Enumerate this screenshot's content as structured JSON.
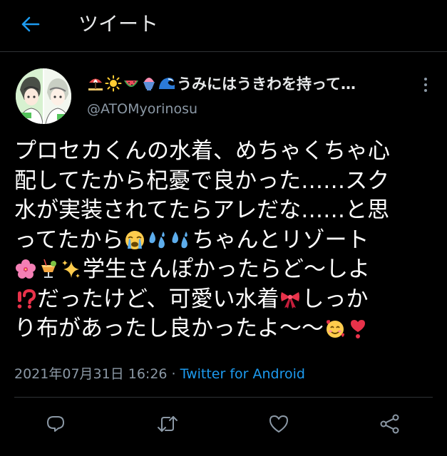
{
  "header": {
    "title": "ツイート",
    "back_icon": "arrow-left-icon"
  },
  "tweet": {
    "author": {
      "display_name_text": "うみにはうきわを持って…",
      "display_name_emoji": [
        "beach-umbrella",
        "sun",
        "watermelon",
        "shaved-ice",
        "wave"
      ],
      "handle": "@ATOMyorinosu"
    },
    "lines": [
      {
        "text": "プロセカくんの水着、めちゃくちゃ心"
      },
      {
        "text": "配してたから杞憂で良かった……スク"
      },
      {
        "text": "水が実装されてたらアレだな……と思"
      },
      {
        "parts": [
          "ってたから",
          "",
          "",
          "ちゃんとリゾート"
        ],
        "emoji": [
          "loudly-crying-face",
          "sweat-droplets",
          "sweat-droplets"
        ]
      },
      {
        "parts": [
          "",
          "",
          "",
          "学生さんぽかったらど〜しよ"
        ],
        "emoji": [
          "hibiscus",
          "tropical-drink",
          "sparkles"
        ]
      },
      {
        "parts": [
          "",
          "だったけど、可愛い水着",
          "しっか"
        ],
        "emoji": [
          "exclamation-question-mark",
          "ribbon"
        ]
      },
      {
        "parts": [
          "り布があったし良かったよ〜〜",
          "",
          ""
        ],
        "emoji": [
          "smiling-face-with-hearts",
          "heavy-heart-exclamation"
        ]
      }
    ],
    "timestamp": "2021年07月31日 16:26 · ",
    "source": "Twitter for Android"
  },
  "actions": {
    "reply_icon": "reply-icon",
    "retweet_icon": "retweet-icon",
    "like_icon": "heart-icon",
    "share_icon": "share-icon"
  },
  "colors": {
    "background": "#000000",
    "accent": "#1d9bf0",
    "secondary_text": "#8b98a5",
    "divider": "#2f3336"
  }
}
